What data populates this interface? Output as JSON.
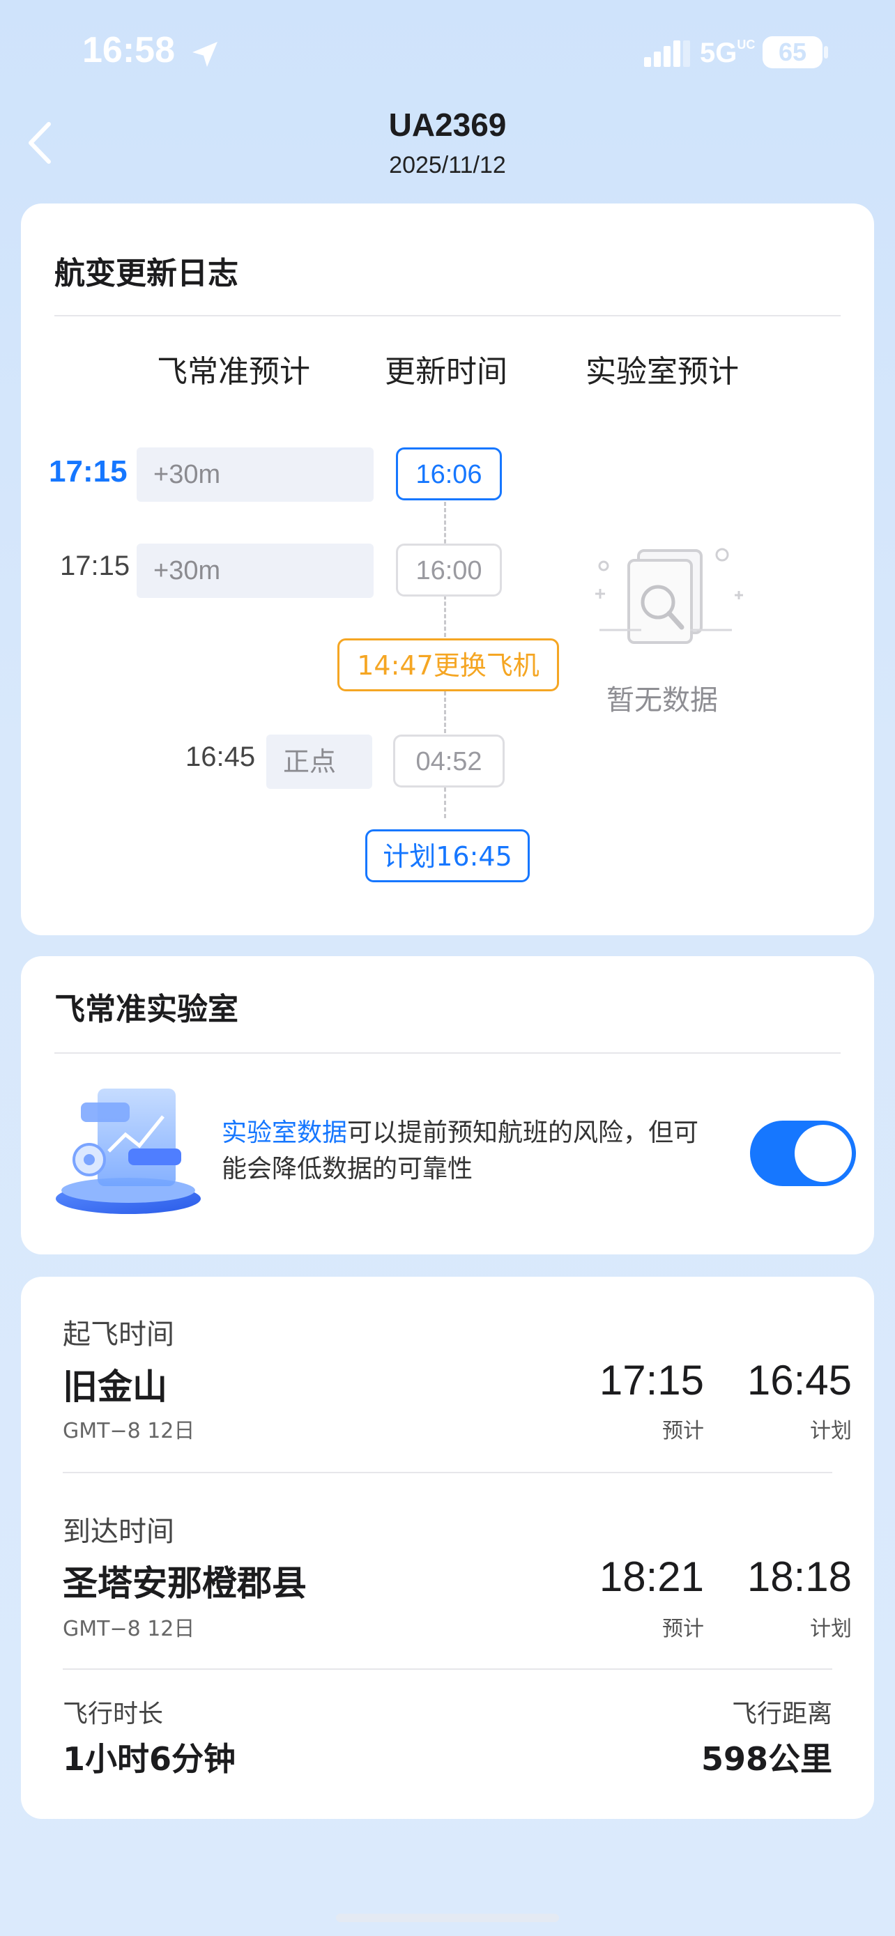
{
  "status_bar": {
    "time": "16:58",
    "network": "5G",
    "network_sub": "UC",
    "battery": "65"
  },
  "header": {
    "flight_no": "UA2369",
    "date": "2025/11/12"
  },
  "log_card": {
    "title": "航变更新日志",
    "columns": [
      "飞常准预计",
      "更新时间",
      "实验室预计"
    ],
    "entries": [
      {
        "est_time": "17:15",
        "delay": "+30m",
        "update_time": "16:06"
      },
      {
        "est_time": "17:15",
        "delay": "+30m",
        "update_time": "16:00"
      },
      {
        "event": "14:47更换飞机"
      },
      {
        "est_time": "16:45",
        "delay": "正点",
        "update_time": "04:52"
      },
      {
        "plan": "计划16:45"
      }
    ],
    "empty_text": "暂无数据"
  },
  "lab_card": {
    "title": "飞常准实验室",
    "desc_highlight": "实验室数据",
    "desc_rest": "可以提前预知航班的风险，但可能会降低数据的可靠性",
    "toggle_on": true
  },
  "info_card": {
    "departure": {
      "label": "起飞时间",
      "city": "旧金山",
      "tz": "GMT−8 12日",
      "est": "17:15",
      "est_label": "预计",
      "plan": "16:45",
      "plan_label": "计划"
    },
    "arrival": {
      "label": "到达时间",
      "city": "圣塔安那橙郡县",
      "tz": "GMT−8 12日",
      "est": "18:21",
      "est_label": "预计",
      "plan": "18:18",
      "plan_label": "计划"
    },
    "duration": {
      "label": "飞行时长",
      "value": "1小时6分钟"
    },
    "distance": {
      "label": "飞行距离",
      "value": "598公里"
    }
  },
  "colors": {
    "accent": "#1677ff",
    "warning": "#f5a623",
    "background": "#d3e5fb"
  }
}
